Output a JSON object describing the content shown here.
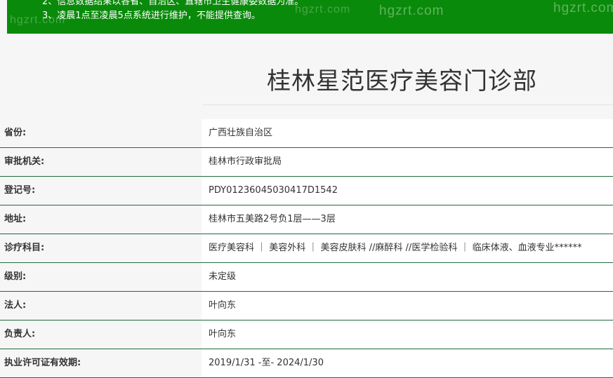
{
  "notice": {
    "lines": [
      "2、信息数据结果以各省、自治区、直辖市卫生健康委数据为准。",
      "3、凌晨1点至凌晨5点系统进行维护，不能提供查询。"
    ],
    "watermark": "hgzrt.com"
  },
  "page_title": "桂林星范医疗美容门诊部",
  "rows": [
    {
      "label": "省份:",
      "value": "广西壮族自治区"
    },
    {
      "label": "审批机关:",
      "value": "桂林市行政审批局"
    },
    {
      "label": "登记号:",
      "value": "PDY01236045030417D1542"
    },
    {
      "label": "地址:",
      "value": "桂林市五美路2号负1层——3层"
    },
    {
      "label": "诊疗科目:",
      "value": "医疗美容科 ｜ 美容外科 ｜ 美容皮肤科 //麻醉科 //医学检验科 ｜ 临床体液、血液专业******"
    },
    {
      "label": "级别:",
      "value": "未定级"
    },
    {
      "label": "法人:",
      "value": "叶向东"
    },
    {
      "label": "负责人:",
      "value": "叶向东"
    },
    {
      "label": "执业许可证有效期:",
      "value": "2019/1/31 -至- 2024/1/30"
    }
  ],
  "colors": {
    "accent": "#0a8a0a",
    "row_border": "#1e6b3a"
  }
}
